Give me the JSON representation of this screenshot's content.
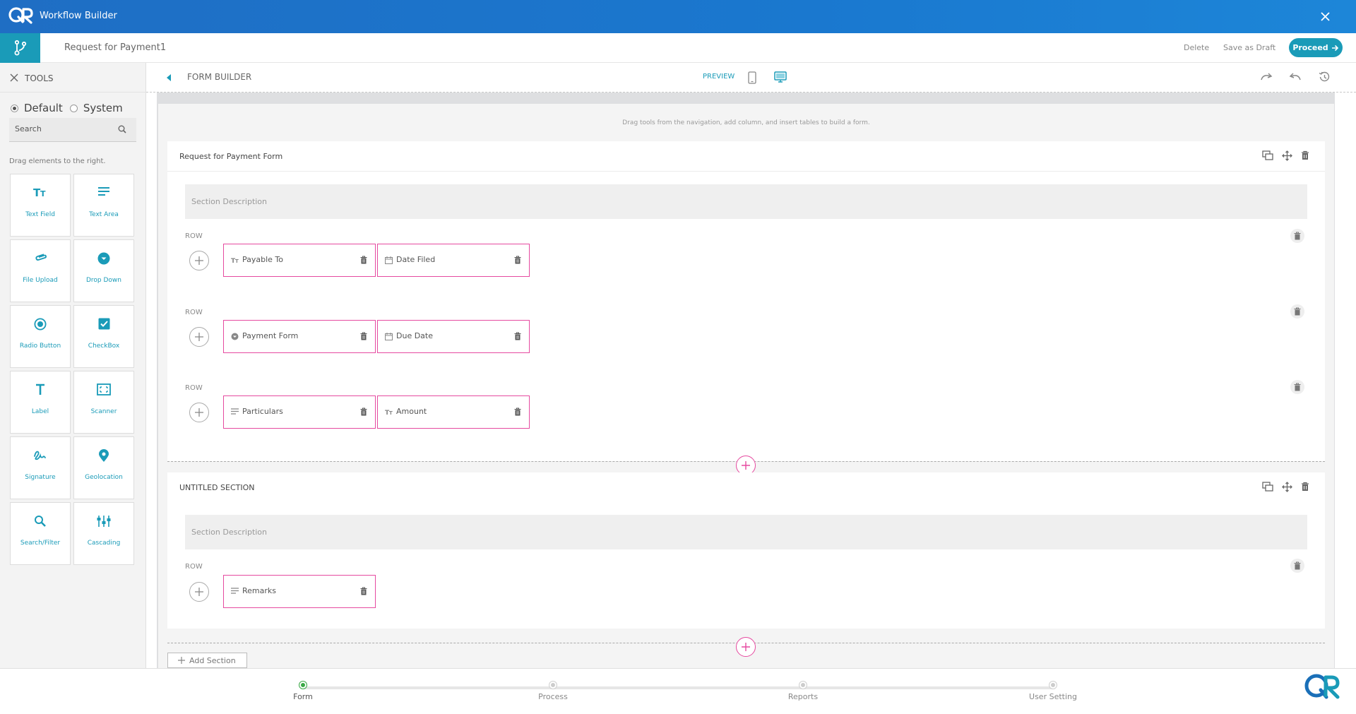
{
  "app": {
    "title": "Workflow Builder"
  },
  "document": {
    "title": "Request for Payment1",
    "delete_label": "Delete",
    "draft_label": "Save as Draft",
    "proceed_label": "Proceed"
  },
  "tools": {
    "header": "TOOLS",
    "options": [
      {
        "label": "Default",
        "selected": true
      },
      {
        "label": "System",
        "selected": false
      }
    ],
    "search_placeholder": "Search",
    "hint": "Drag elements to the right.",
    "items": [
      {
        "label": "Text Field",
        "icon": "text-field-icon"
      },
      {
        "label": "Text Area",
        "icon": "text-area-icon"
      },
      {
        "label": "File Upload",
        "icon": "paperclip-icon"
      },
      {
        "label": "Drop Down",
        "icon": "dropdown-icon"
      },
      {
        "label": "Radio Button",
        "icon": "radio-icon"
      },
      {
        "label": "CheckBox",
        "icon": "checkbox-icon"
      },
      {
        "label": "Label",
        "icon": "label-icon"
      },
      {
        "label": "Scanner",
        "icon": "scanner-icon"
      },
      {
        "label": "Signature",
        "icon": "signature-icon"
      },
      {
        "label": "Geolocation",
        "icon": "location-pin-icon"
      },
      {
        "label": "Search/Filter",
        "icon": "search-icon"
      },
      {
        "label": "Cascading",
        "icon": "cascading-icon"
      }
    ]
  },
  "builder": {
    "title": "FORM BUILDER",
    "preview_label": "PREVIEW",
    "drag_hint": "Drag tools from the navigation, add column, and insert tables to build a form.",
    "row_label": "ROW",
    "add_section_label": "Add Section",
    "sections": [
      {
        "title": "Request for Payment Form",
        "description_placeholder": "Section Description",
        "rows": [
          [
            {
              "label": "Payable To",
              "icon": "text-field-icon"
            },
            {
              "label": "Date Filed",
              "icon": "calendar-icon"
            }
          ],
          [
            {
              "label": "Payment Form",
              "icon": "dropdown-icon"
            },
            {
              "label": "Due Date",
              "icon": "calendar-icon"
            }
          ],
          [
            {
              "label": "Particulars",
              "icon": "text-area-icon"
            },
            {
              "label": "Amount",
              "icon": "text-field-icon"
            }
          ]
        ]
      },
      {
        "title": "UNTITLED SECTION",
        "description_placeholder": "Section Description",
        "rows": [
          [
            {
              "label": "Remarks",
              "icon": "text-area-icon"
            }
          ]
        ]
      }
    ]
  },
  "steps": [
    {
      "label": "Form",
      "active": true
    },
    {
      "label": "Process",
      "active": false
    },
    {
      "label": "Reports",
      "active": false
    },
    {
      "label": "User Setting",
      "active": false
    }
  ],
  "colors": {
    "brand_blue": "#1f6ec4",
    "teal": "#1a9bb8",
    "field_border": "#e64aa0",
    "active_step": "#39a845"
  }
}
